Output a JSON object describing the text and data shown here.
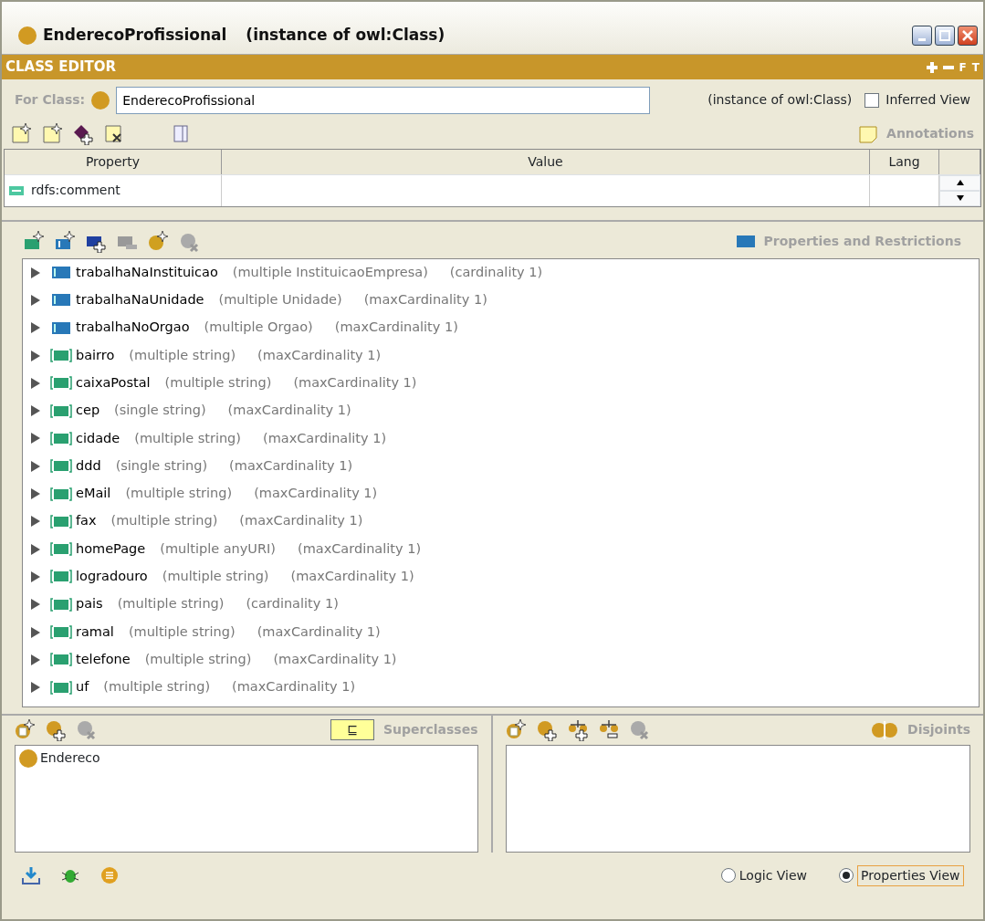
{
  "window": {
    "title": "EnderecoProfissional",
    "subtitle": "(instance of owl:Class)"
  },
  "editor": {
    "title": "CLASS EDITOR",
    "header_buttons": [
      "F",
      "T"
    ],
    "for_class_label": "For Class:",
    "class_name": "EnderecoProfissional",
    "instance_of": "(instance of owl:Class)",
    "inferred_view": {
      "label": "Inferred View",
      "checked": false
    }
  },
  "annotations": {
    "title": "Annotations",
    "columns": [
      "Property",
      "Value",
      "Lang"
    ],
    "rows": [
      {
        "property": "rdfs:comment",
        "value": "",
        "lang": ""
      }
    ]
  },
  "properties": {
    "title": "Properties and Restrictions",
    "items": [
      {
        "kind": "object",
        "name": "trabalhaNaInstituicao",
        "type": "(multiple InstituicaoEmpresa)",
        "restriction": "(cardinality 1)"
      },
      {
        "kind": "object",
        "name": "trabalhaNaUnidade",
        "type": "(multiple Unidade)",
        "restriction": "(maxCardinality 1)"
      },
      {
        "kind": "object",
        "name": "trabalhaNoOrgao",
        "type": "(multiple Orgao)",
        "restriction": "(maxCardinality 1)"
      },
      {
        "kind": "datatype",
        "name": "bairro",
        "type": "(multiple string)",
        "restriction": "(maxCardinality 1)"
      },
      {
        "kind": "datatype",
        "name": "caixaPostal",
        "type": "(multiple string)",
        "restriction": "(maxCardinality 1)"
      },
      {
        "kind": "datatype",
        "name": "cep",
        "type": "(single string)",
        "restriction": "(maxCardinality 1)"
      },
      {
        "kind": "datatype",
        "name": "cidade",
        "type": "(multiple string)",
        "restriction": "(maxCardinality 1)"
      },
      {
        "kind": "datatype",
        "name": "ddd",
        "type": "(single string)",
        "restriction": "(maxCardinality 1)"
      },
      {
        "kind": "datatype",
        "name": "eMail",
        "type": "(multiple string)",
        "restriction": "(maxCardinality 1)"
      },
      {
        "kind": "datatype",
        "name": "fax",
        "type": "(multiple string)",
        "restriction": "(maxCardinality 1)"
      },
      {
        "kind": "datatype",
        "name": "homePage",
        "type": "(multiple anyURI)",
        "restriction": "(maxCardinality 1)"
      },
      {
        "kind": "datatype",
        "name": "logradouro",
        "type": "(multiple string)",
        "restriction": "(maxCardinality 1)"
      },
      {
        "kind": "datatype",
        "name": "pais",
        "type": "(multiple string)",
        "restriction": "(cardinality 1)"
      },
      {
        "kind": "datatype",
        "name": "ramal",
        "type": "(multiple string)",
        "restriction": "(maxCardinality 1)"
      },
      {
        "kind": "datatype",
        "name": "telefone",
        "type": "(multiple string)",
        "restriction": "(maxCardinality 1)"
      },
      {
        "kind": "datatype",
        "name": "uf",
        "type": "(multiple string)",
        "restriction": "(maxCardinality 1)"
      }
    ]
  },
  "superclasses": {
    "title": "Superclasses",
    "symbol": "⊑",
    "items": [
      "Endereco"
    ]
  },
  "disjoints": {
    "title": "Disjoints"
  },
  "views": [
    {
      "label": "Logic View",
      "selected": false
    },
    {
      "label": "Properties View",
      "selected": true
    }
  ]
}
